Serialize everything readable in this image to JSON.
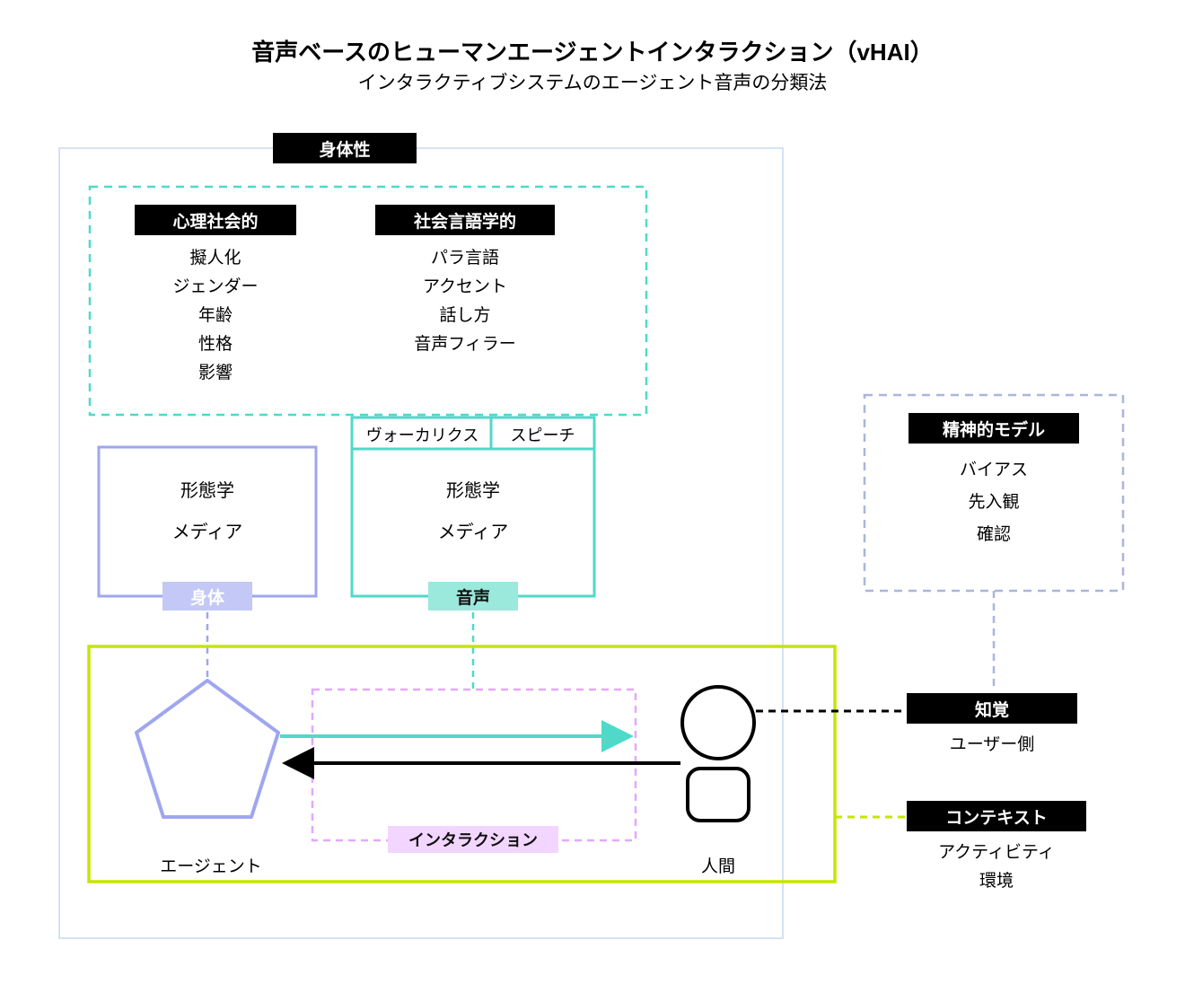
{
  "title": "音声ベースのヒューマンエージェントインタラクション（vHAI）",
  "subtitle": "インタラクティブシステムのエージェント音声の分類法",
  "embodiment_header": "身体性",
  "psychosocial": {
    "header": "心理社会的",
    "items": [
      "擬人化",
      "ジェンダー",
      "年齢",
      "性格",
      "影響"
    ]
  },
  "sociolinguistic": {
    "header": "社会言語学的",
    "items": [
      "パラ言語",
      "アクセント",
      "話し方",
      "音声フィラー"
    ]
  },
  "body_box": {
    "items": [
      "形態学",
      "メディア"
    ],
    "footer": "身体"
  },
  "voice_box": {
    "tabs": [
      "ヴォーカリクス",
      "スピーチ"
    ],
    "items": [
      "形態学",
      "メディア"
    ],
    "footer": "音声"
  },
  "agent_label": "エージェント",
  "human_label": "人間",
  "interaction_label": "インタラクション",
  "mental_model": {
    "header": "精神的モデル",
    "items": [
      "バイアス",
      "先入観",
      "確認"
    ]
  },
  "perception": {
    "header": "知覚",
    "caption": "ユーザー側"
  },
  "context": {
    "header": "コンテキスト",
    "items": [
      "アクティビティ",
      "環境"
    ]
  },
  "colors": {
    "teal": "#4fd9c9",
    "lavender": "#9fa6f0",
    "yellowgreen": "#c6e500",
    "pink": "#e3a8ff",
    "pink_fill": "#f3d6ff",
    "slate": "#a9b6dc",
    "outer": "#d6e2f5",
    "body_fill": "#c3c8f6",
    "voice_fill": "#9be8dc"
  }
}
